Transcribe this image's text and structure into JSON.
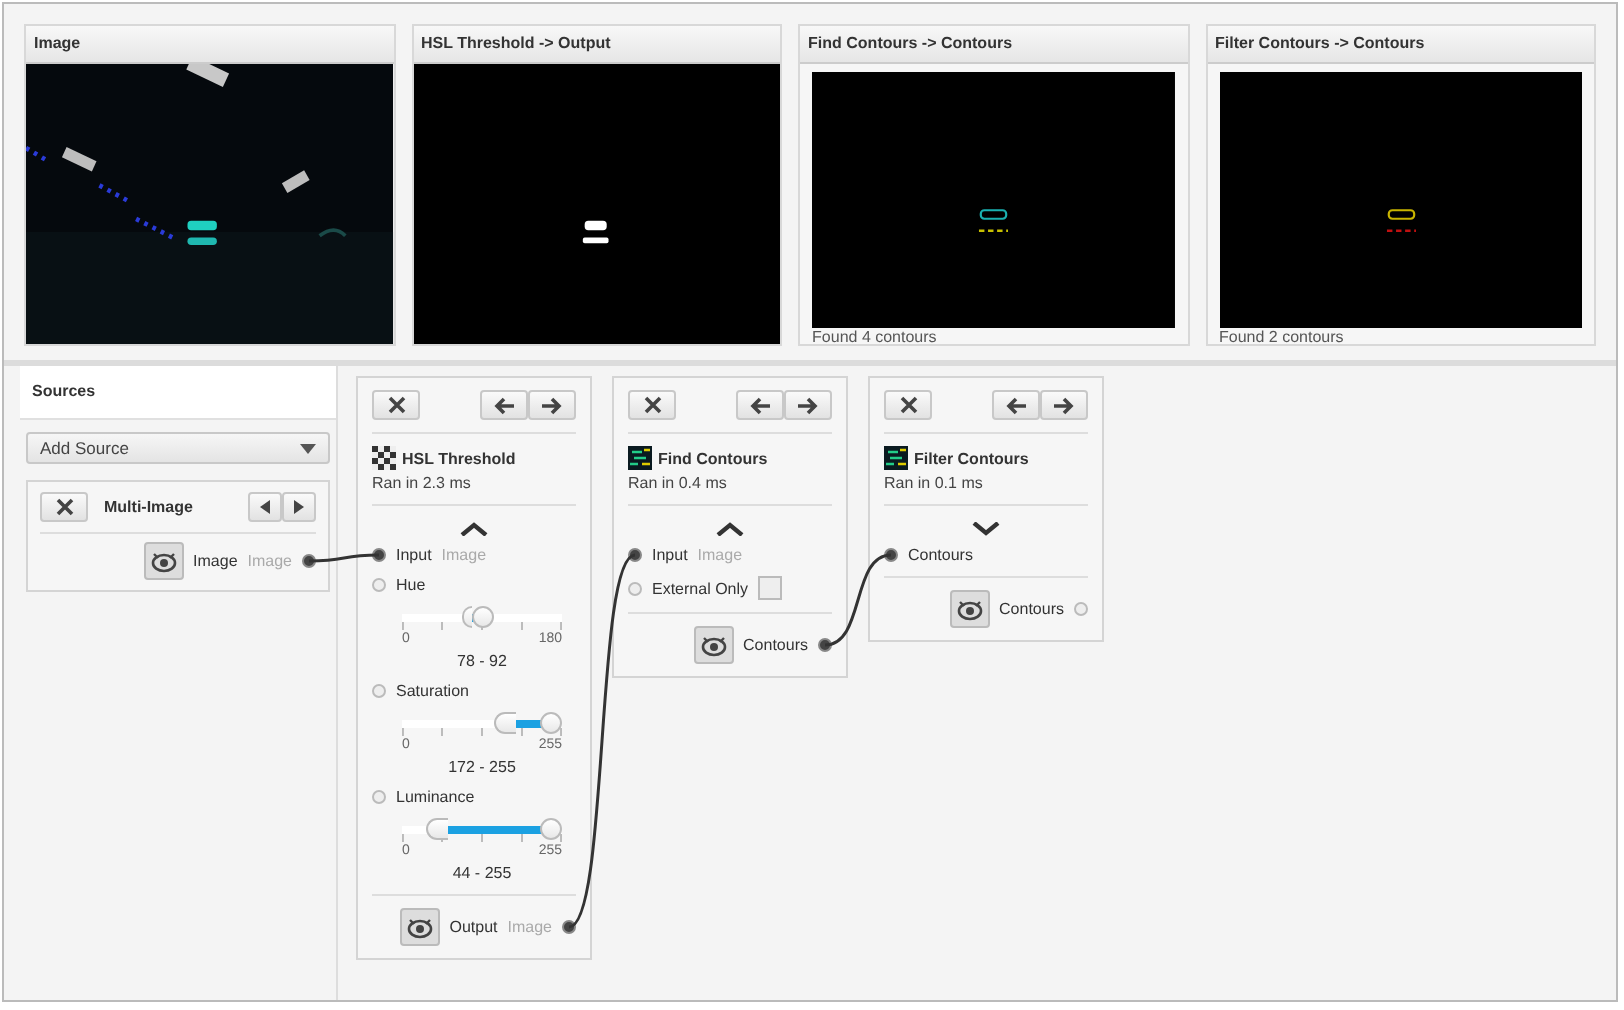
{
  "previews": [
    {
      "title": "Image",
      "kind": "camera"
    },
    {
      "title": "HSL Threshold -> Output",
      "kind": "mask"
    },
    {
      "title": "Find Contours -> Contours",
      "kind": "contours",
      "caption": "Found 4 contours"
    },
    {
      "title": "Filter Contours -> Contours",
      "kind": "filtered",
      "caption": "Found 2 contours"
    }
  ],
  "sources": {
    "title": "Sources",
    "add_source": "Add Source",
    "items": [
      {
        "name": "Multi-Image",
        "outputs": [
          {
            "label": "Image",
            "type": "Image",
            "connected": true
          }
        ]
      }
    ]
  },
  "steps": [
    {
      "name": "HSL Threshold",
      "kind": "threshold",
      "time": "Ran in 2.3 ms",
      "expanded": true,
      "inputs": [
        {
          "kind": "socket",
          "label": "Input",
          "type": "Image",
          "connected": true
        },
        {
          "kind": "range",
          "label": "Hue",
          "connected": false,
          "min": "0",
          "max": "180",
          "thumbs": [
            {
              "level": 0.43
            },
            {
              "level": 0.51
            }
          ],
          "reading": "78 - 92"
        },
        {
          "kind": "range",
          "label": "Saturation",
          "connected": false,
          "min": "0",
          "max": "255",
          "thumbs": [
            {
              "level": 0.67
            },
            {
              "level": 1
            }
          ],
          "reading": "172 - 255"
        },
        {
          "kind": "range",
          "label": "Luminance",
          "connected": false,
          "min": "0",
          "max": "255",
          "thumbs": [
            {
              "level": 0.17
            },
            {
              "level": 1
            }
          ],
          "reading": "44 - 255"
        }
      ],
      "outputs": [
        {
          "label": "Output",
          "type": "Image",
          "connected": true
        }
      ]
    },
    {
      "name": "Find Contours",
      "kind": "contours",
      "time": "Ran in 0.4 ms",
      "expanded": true,
      "inputs": [
        {
          "kind": "socket",
          "label": "Input",
          "type": "Image",
          "connected": true
        },
        {
          "kind": "checkbox",
          "label": "External Only",
          "connected": false,
          "checked": false
        }
      ],
      "outputs": [
        {
          "label": "Contours",
          "connected": true
        }
      ]
    },
    {
      "name": "Filter Contours",
      "kind": "contours",
      "time": "Ran in 0.1 ms",
      "expanded": false,
      "inputs": [
        {
          "kind": "socket",
          "label": "Contours",
          "connected": true
        }
      ],
      "outputs": [
        {
          "label": "Contours",
          "connected": false
        }
      ]
    }
  ]
}
